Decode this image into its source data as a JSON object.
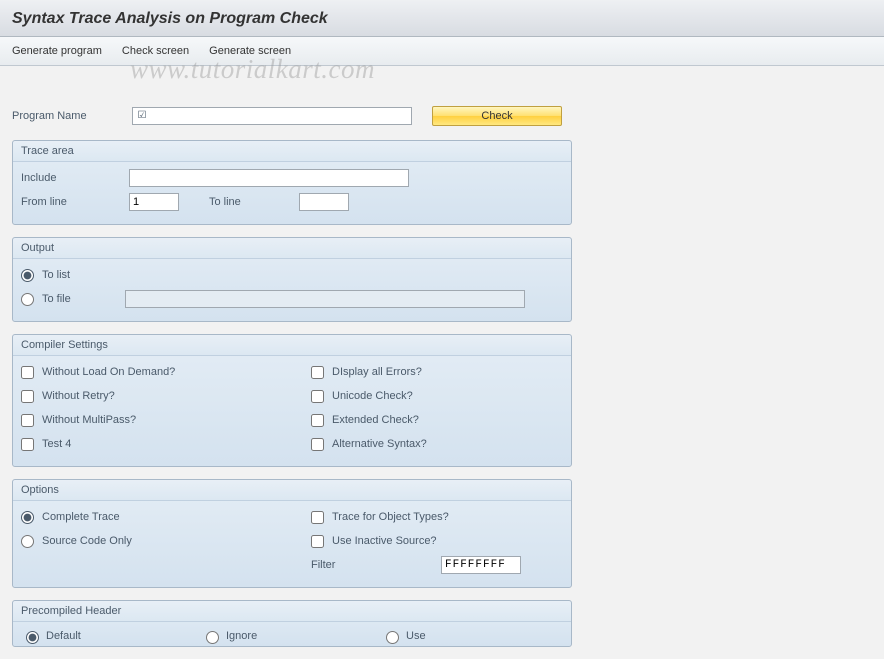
{
  "header": {
    "title": "Syntax Trace Analysis on Program Check"
  },
  "toolbar": {
    "generate_program": "Generate program",
    "check_screen": "Check screen",
    "generate_screen": "Generate screen"
  },
  "watermark": "www.tutorialkart.com",
  "programName": {
    "label": "Program Name",
    "value": "",
    "requiredMark": "☑"
  },
  "checkButton": "Check",
  "traceArea": {
    "title": "Trace area",
    "includeLabel": "Include",
    "includeValue": "",
    "fromLineLabel": "From line",
    "fromLineValue": "1",
    "toLineLabel": "To line",
    "toLineValue": ""
  },
  "output": {
    "title": "Output",
    "toList": "To list",
    "toFile": "To file",
    "fileValue": ""
  },
  "compiler": {
    "title": "Compiler Settings",
    "withoutLoad": "Without Load On Demand?",
    "withoutRetry": "Without Retry?",
    "withoutMulti": "Without MultiPass?",
    "test4": "Test 4",
    "displayErrors": "DIsplay all Errors?",
    "unicodeCheck": "Unicode Check?",
    "extendedCheck": "Extended Check?",
    "altSyntax": "Alternative Syntax?"
  },
  "options": {
    "title": "Options",
    "completeTrace": "Complete Trace",
    "sourceOnly": "Source Code Only",
    "traceObj": "Trace for Object Types?",
    "inactive": "Use Inactive Source?",
    "filterLabel": "Filter",
    "filterValue": "FFFFFFFF"
  },
  "precompiled": {
    "title": "Precompiled Header",
    "default": "Default",
    "ignore": "Ignore",
    "use": "Use"
  }
}
